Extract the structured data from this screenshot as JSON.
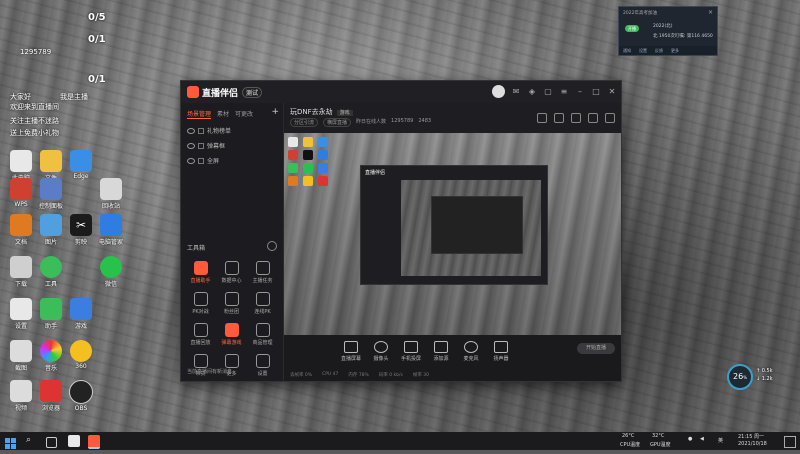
{
  "overlay": {
    "counters": [
      "0/5",
      "0/1",
      "0/1"
    ],
    "viewer_id": "1295789",
    "text_lines": [
      "大家好",
      "我是主播",
      "欢迎来到直播间",
      "关注主播不迷路",
      "送上免费小礼物"
    ]
  },
  "desktop": {
    "icons": [
      {
        "label": "此电脑"
      },
      {
        "label": "文件"
      },
      {
        "label": "Edge"
      },
      {
        "label": "回收站"
      },
      {
        "label": "WPS"
      },
      {
        "label": "控制面板"
      },
      {
        "label": "文档"
      },
      {
        "label": "图片"
      },
      {
        "label": "下载"
      },
      {
        "label": "工具"
      },
      {
        "label": "设置"
      },
      {
        "label": "助手"
      },
      {
        "label": "剪映"
      },
      {
        "label": "电脑管家"
      },
      {
        "label": "游戏"
      },
      {
        "label": "360"
      },
      {
        "label": "微信"
      },
      {
        "label": "浏览器"
      },
      {
        "label": "截图"
      },
      {
        "label": "音乐"
      },
      {
        "label": "视频"
      },
      {
        "label": "OBS"
      }
    ]
  },
  "app": {
    "title": "直播伴侣",
    "version": "测试",
    "left_tabs": [
      "场景管理",
      "素材",
      "可更改"
    ],
    "sources": [
      "礼物榜单",
      "弹幕框",
      "全屏"
    ],
    "tools_header": "工具箱",
    "tools": [
      {
        "label": "直播助手",
        "accent": true
      },
      {
        "label": "数据中心",
        "accent": false
      },
      {
        "label": "主播任务",
        "accent": false
      },
      {
        "label": "PK对战",
        "accent": false
      },
      {
        "label": "粉丝团",
        "accent": false
      },
      {
        "label": "连线PK",
        "accent": false
      },
      {
        "label": "直播回放",
        "accent": false
      },
      {
        "label": "弹幕游戏",
        "accent": true
      },
      {
        "label": "商品管理",
        "accent": false
      },
      {
        "label": "带货",
        "accent": false
      },
      {
        "label": "更多",
        "accent": false
      },
      {
        "label": "设置",
        "accent": false
      }
    ],
    "footnote": "当前直播间有新消息",
    "room": {
      "title": "玩DNF去永劫",
      "tag": "游戏",
      "category": "分区引流",
      "mode": "横屏直播",
      "viewer_label": "昨日在线人数",
      "viewer_id": "1295789",
      "likes": "2483"
    },
    "controls": [
      {
        "label": "直播屏幕"
      },
      {
        "label": "摄像头"
      },
      {
        "label": "手机投屏"
      },
      {
        "label": "添加源"
      },
      {
        "label": "麦克风"
      },
      {
        "label": "扬声器"
      }
    ],
    "start_button": "开始直播",
    "status": [
      "丢帧率 0%",
      "CPU 47",
      "内存 78%",
      "码率 0 kb/s",
      "帧率 30"
    ]
  },
  "popup": {
    "title": "2022年高考加油",
    "badge": "开播",
    "lines": [
      "2022(北)",
      "北 1950次叮嘱: 第116 4650"
    ],
    "actions": [
      "通知",
      "设置",
      "反馈",
      "更多"
    ]
  },
  "gauge": {
    "value": "26",
    "unit": "%",
    "up": "↑ 0.5k",
    "down": "↓ 1.2k"
  },
  "taskbar": {
    "temp_cpu": "26°C",
    "temp_cpu_label": "CPU温度",
    "temp_gpu": "32°C",
    "temp_gpu_label": "GPU温度",
    "lang": "英",
    "time": "21:15 周一",
    "date": "2021/10/18"
  }
}
